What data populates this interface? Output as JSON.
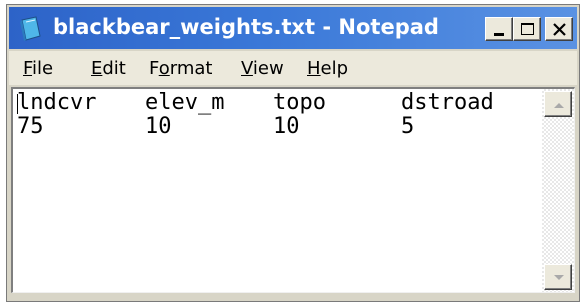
{
  "window": {
    "title": "blackbear_weights.txt - Notepad",
    "icon": "notepad-icon",
    "controls": [
      "minimize-icon",
      "maximize-icon",
      "close-icon"
    ]
  },
  "menu": {
    "items": [
      {
        "label": "File",
        "underline": "F",
        "rest": "ile"
      },
      {
        "label": "Edit",
        "underline": "E",
        "rest": "dit"
      },
      {
        "label": "Format",
        "pre": "F",
        "underline": "o",
        "rest": "rmat"
      },
      {
        "label": "View",
        "underline": "V",
        "rest": "iew"
      },
      {
        "label": "Help",
        "underline": "H",
        "rest": "elp"
      }
    ]
  },
  "content": {
    "header": [
      "lndcvr",
      "elev_m",
      "topo",
      "dstroad"
    ],
    "values": [
      "75",
      "10",
      "10",
      "5"
    ]
  },
  "colors": {
    "titlebar": "#2d63c8",
    "chrome": "#ece9dc"
  }
}
